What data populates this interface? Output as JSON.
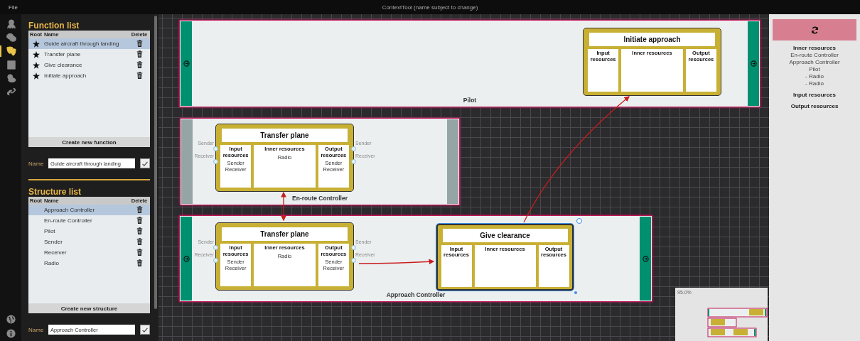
{
  "window": {
    "menu": [
      "File"
    ],
    "title": "ContextTool (name subject to change)"
  },
  "nav_rail": {
    "items": [
      {
        "selected": false
      },
      {
        "selected": false
      },
      {
        "selected": true
      },
      {
        "selected": false
      },
      {
        "selected": false
      },
      {
        "selected": false
      }
    ]
  },
  "function_list": {
    "title": "Function list",
    "columns": [
      "Root",
      "Name",
      "Delete"
    ],
    "rows": [
      {
        "name": "Guide aircraft through landing",
        "root": true,
        "selected": true
      },
      {
        "name": "Transfer plane",
        "root": true,
        "selected": false
      },
      {
        "name": "Give clearance",
        "root": true,
        "selected": false
      },
      {
        "name": "Initiate approach",
        "root": true,
        "selected": false
      }
    ],
    "create_button": "Create new function",
    "name_label": "Name",
    "name_value": "Guide aircraft through landing"
  },
  "structure_list": {
    "title": "Structure list",
    "columns": [
      "Root",
      "Name",
      "Delete"
    ],
    "rows": [
      {
        "name": "Approach Controller",
        "root": false,
        "selected": true
      },
      {
        "name": "En-route Controller",
        "root": false,
        "selected": false
      },
      {
        "name": "Pilot",
        "root": false,
        "selected": false
      },
      {
        "name": "Sender",
        "root": false,
        "selected": false
      },
      {
        "name": "Receiver",
        "root": false,
        "selected": false
      },
      {
        "name": "Radio",
        "root": false,
        "selected": false
      }
    ],
    "create_button": "Create new structure",
    "name_label": "Name",
    "name_value": "Approach Controller"
  },
  "canvas": {
    "structures": [
      {
        "label": "Pilot",
        "color": "#008f6f",
        "toggle_icons": true,
        "functions": [
          {
            "title": "Initiate approach",
            "selected": false,
            "columns": [
              {
                "header": "Input resources"
              },
              {
                "header": "Inner resources"
              },
              {
                "header": "Output resources"
              }
            ]
          }
        ]
      },
      {
        "label": "En-route Controller",
        "color": "#95a5a6",
        "toggle_icons": false,
        "functions": [
          {
            "title": "Transfer plane",
            "selected": false,
            "input_ports": [
              "Sender",
              "Receiver"
            ],
            "output_ports": [
              "Sender",
              "Receiver"
            ],
            "columns": [
              {
                "header": "Input resources",
                "items": [
                  "Sender",
                  "Receiver"
                ]
              },
              {
                "header": "Inner resources",
                "items": [
                  "Radio"
                ]
              },
              {
                "header": "Output resources",
                "items": [
                  "Sender",
                  "Receiver"
                ]
              }
            ]
          }
        ]
      },
      {
        "label": "Approach Controller",
        "color": "#008f6f",
        "toggle_icons": true,
        "functions": [
          {
            "title": "Transfer plane",
            "selected": false,
            "input_ports": [
              "Sender",
              "Receiver"
            ],
            "output_ports": [
              "Sender",
              "Receiver"
            ],
            "columns": [
              {
                "header": "Input resources",
                "items": [
                  "Sender",
                  "Receiver"
                ]
              },
              {
                "header": "Inner resources",
                "items": [
                  "Radio"
                ]
              },
              {
                "header": "Output resources",
                "items": [
                  "Sender",
                  "Receiver"
                ]
              }
            ]
          },
          {
            "title": "Give clearance",
            "selected": true,
            "columns": [
              {
                "header": "Input resources"
              },
              {
                "header": "Inner resources"
              },
              {
                "header": "Output resources"
              }
            ]
          }
        ]
      }
    ],
    "minimap": {
      "zoom": "95.0%"
    }
  },
  "details": {
    "sections": [
      {
        "heading": "Inner resources",
        "items": [
          "En-route Controller",
          "Approach Controller",
          "Pilot",
          "- Radio",
          "- Radio"
        ]
      },
      {
        "heading": "Input resources"
      },
      {
        "heading": "Output resources"
      }
    ]
  }
}
